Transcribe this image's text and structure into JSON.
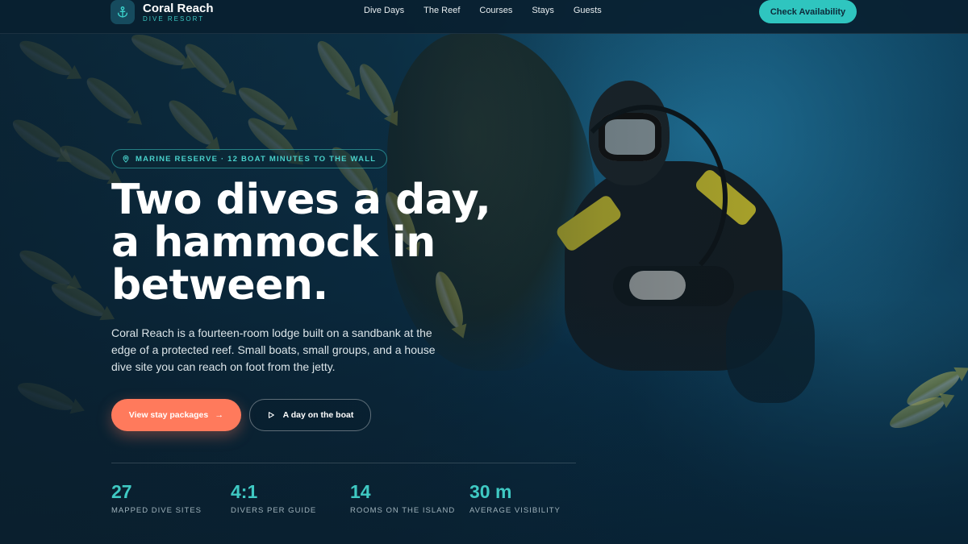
{
  "brand": {
    "name": "Coral Reach",
    "subtitle": "DIVE RESORT",
    "icon": "anchor-icon"
  },
  "nav": {
    "links": [
      "Dive Days",
      "The Reef",
      "Courses",
      "Stays",
      "Guests"
    ],
    "cta_label": "Check Availability"
  },
  "hero": {
    "eyebrow": "MARINE RESERVE · 12 BOAT MINUTES TO THE WALL",
    "headline_lines": [
      "Two dives a day,",
      "a hammock in",
      "between."
    ],
    "lede": "Coral Reach is a fourteen-room lodge built on a sandbank at the edge of a protected reef. Small boats, small groups, and a house dive site you can reach on foot from the jetty.",
    "primary_button": "View stay packages",
    "secondary_button": "A day on the boat"
  },
  "stats": [
    {
      "value": "27",
      "label": "MAPPED DIVE SITES"
    },
    {
      "value": "4:1",
      "label": "DIVERS PER GUIDE"
    },
    {
      "value": "14",
      "label": "ROOMS ON THE ISLAND"
    },
    {
      "value": "30 m",
      "label": "AVERAGE VISIBILITY"
    }
  ],
  "colors": {
    "accent": "#2fc5bf",
    "coral": "#ff7a5c",
    "nav_bg": "#092030",
    "stat_value": "#3fc9c3"
  }
}
